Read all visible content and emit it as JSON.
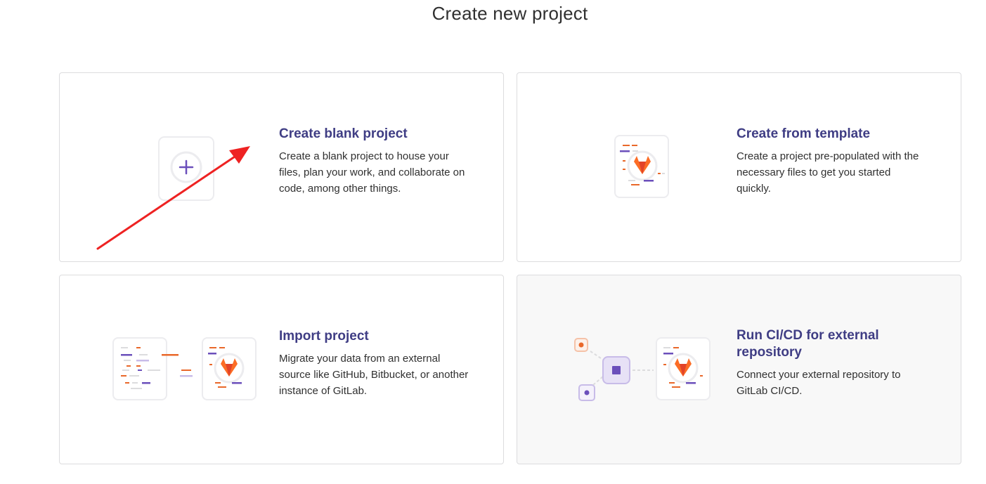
{
  "page": {
    "title": "Create new project"
  },
  "cards": [
    {
      "title": "Create blank project",
      "description": "Create a blank project to house your files, plan your work, and collaborate on code, among other things.",
      "icon": "plus-icon"
    },
    {
      "title": "Create from template",
      "description": "Create a project pre-populated with the necessary files to get you started quickly.",
      "icon": "template-icon"
    },
    {
      "title": "Import project",
      "description": "Migrate your data from an external source like GitHub, Bitbucket, or another instance of GitLab.",
      "icon": "import-icon"
    },
    {
      "title": "Run CI/CD for external repository",
      "description": "Connect your external repository to GitLab CI/CD.",
      "icon": "cicd-icon"
    }
  ],
  "colors": {
    "accent": "#3f3d84",
    "orange": "#e9682a",
    "purple": "#6b4fbb",
    "annotation_arrow": "#ee2222"
  }
}
